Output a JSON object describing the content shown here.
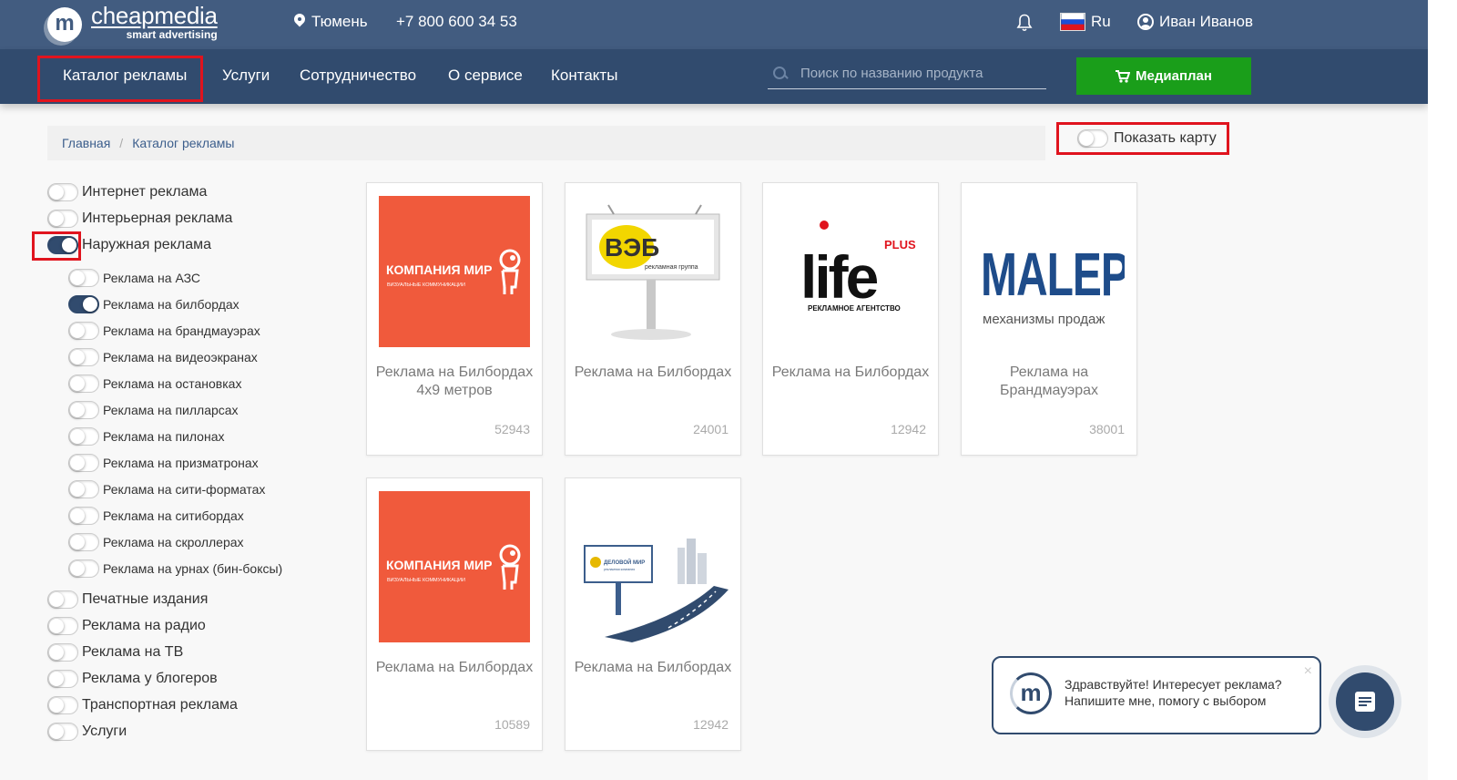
{
  "header": {
    "logo_letter": "m",
    "logo_name": "cheapmedia",
    "logo_tagline": "smart advertising",
    "city": "Тюмень",
    "phone": "+7 800 600 34 53",
    "language": "Ru",
    "user_name": "Иван Иванов"
  },
  "nav": {
    "items": [
      "Каталог рекламы",
      "Услуги",
      "Сотрудничество",
      "О сервисе",
      "Контакты"
    ],
    "search_placeholder": "Поиск по названию продукта",
    "mediaplan_label": "Медиаплан"
  },
  "breadcrumb": {
    "home": "Главная",
    "separator": "/",
    "current": "Каталог рекламы"
  },
  "map_toggle": {
    "label": "Показать карту",
    "on": false
  },
  "sidebar": {
    "categories": [
      {
        "label": "Интернет реклама",
        "on": false
      },
      {
        "label": "Интерьерная реклама",
        "on": false
      },
      {
        "label": "Наружная реклама",
        "on": true
      },
      {
        "label": "Печатные издания",
        "on": false
      },
      {
        "label": "Реклама на радио",
        "on": false
      },
      {
        "label": "Реклама на ТВ",
        "on": false
      },
      {
        "label": "Реклама у блогеров",
        "on": false
      },
      {
        "label": "Транспортная реклама",
        "on": false
      },
      {
        "label": "Услуги",
        "on": false
      }
    ],
    "subcategories": [
      {
        "label": "Реклама на АЗС",
        "on": false
      },
      {
        "label": "Реклама на билбордах",
        "on": true
      },
      {
        "label": "Реклама на брандмауэрах",
        "on": false
      },
      {
        "label": "Реклама на видеоэкранах",
        "on": false
      },
      {
        "label": "Реклама на остановках",
        "on": false
      },
      {
        "label": "Реклама на пилларсах",
        "on": false
      },
      {
        "label": "Реклама на пилонах",
        "on": false
      },
      {
        "label": "Реклама на призматронах",
        "on": false
      },
      {
        "label": "Реклама на сити-форматах",
        "on": false
      },
      {
        "label": "Реклама на ситибордах",
        "on": false
      },
      {
        "label": "Реклама на скроллерах",
        "on": false
      },
      {
        "label": "Реклама на урнах (бин-боксы)",
        "on": false
      }
    ]
  },
  "products": [
    {
      "title": "Реклама на Билбордах 4х9 метров",
      "count": "52943",
      "logo": "kompaniya-mir-logo",
      "logo_text": "КОМПАНИЯ МИР",
      "logo_subtext": "ВИЗУАЛЬНЫЕ КОММУНИКАЦИИ"
    },
    {
      "title": "Реклама на Билбордах",
      "count": "24001",
      "logo": "veb-billboard-logo",
      "logo_text": "ВЭБ",
      "logo_subtext": "рекламная группа"
    },
    {
      "title": "Реклама на Билбордах",
      "count": "12942",
      "logo": "life-plus-logo",
      "logo_text": "life",
      "logo_subtext": "РЕКЛАМНОЕ АГЕНТСТВО",
      "logo_badge": "PLUS"
    },
    {
      "title": "Реклама на Брандмауэрах",
      "count": "38001",
      "logo": "malepo-logo",
      "logo_text": "MALEPO",
      "logo_subtext": "механизмы продаж"
    },
    {
      "title": "Реклама на Билбордах",
      "count": "10589",
      "logo": "kompaniya-mir-logo",
      "logo_text": "КОМПАНИЯ МИР",
      "logo_subtext": "ВИЗУАЛЬНЫЕ КОММУНИКАЦИИ"
    },
    {
      "title": "Реклама на Билбордах",
      "count": "12942",
      "logo": "delovoy-mir-billboard-logo",
      "logo_text": "ДЕЛОВОЙ МИР",
      "logo_subtext": "рекламная компания"
    }
  ],
  "chat": {
    "logo_letter": "m",
    "line1": "Здравствуйте! Интересует реклама?",
    "line2": "Напишите мне, помогу с выбором",
    "close": "×"
  },
  "colors": {
    "topbar": "#425c80",
    "navbar": "#314b6e",
    "accent_green": "#1a9e1a",
    "highlight_red": "#e0141e",
    "mir_orange": "#f05a3c"
  }
}
